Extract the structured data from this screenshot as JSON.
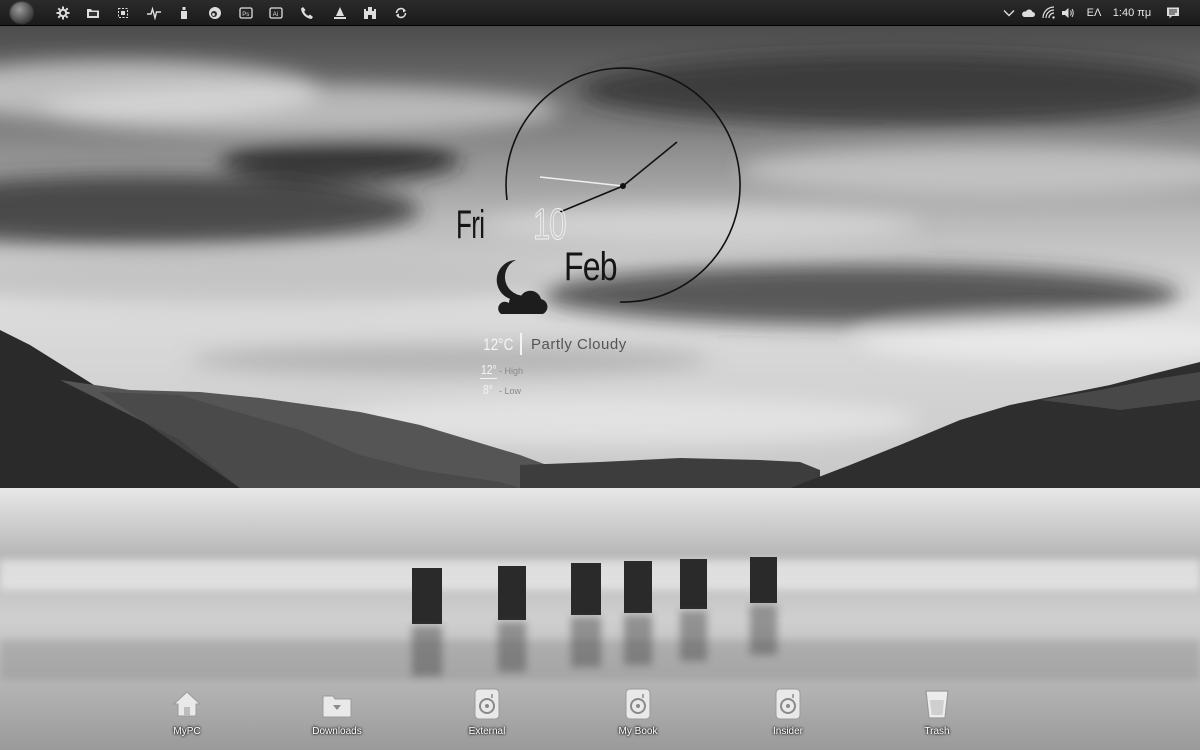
{
  "taskbar": {
    "quick_launch": [
      {
        "icon": "settings-icon"
      },
      {
        "icon": "folder-icon"
      },
      {
        "icon": "screen-capture-icon"
      },
      {
        "icon": "activity-monitor-icon"
      },
      {
        "icon": "bottle-icon"
      },
      {
        "icon": "browser-icon"
      },
      {
        "icon": "photoshop-icon"
      },
      {
        "icon": "illustrator-icon"
      },
      {
        "icon": "phone-icon"
      },
      {
        "icon": "sailing-icon"
      },
      {
        "icon": "castle-icon"
      },
      {
        "icon": "sync-icon"
      }
    ],
    "tray": {
      "chevron_icon": "chevron-down-icon",
      "cloud_icon": "onedrive-cloud-icon",
      "wifi_icon": "wifi-icon",
      "volume_icon": "volume-icon",
      "language": "ΕΛ",
      "time": "1:40 πμ",
      "notification_icon": "action-center-icon"
    }
  },
  "clock_widget": {
    "day": "Fri",
    "date": "10",
    "month": "Feb",
    "time_shown": "1:40"
  },
  "weather_widget": {
    "icon": "moon-cloud-icon",
    "temperature": "12°C",
    "condition": "Partly Cloudy",
    "high": "12°",
    "high_label": "- High",
    "low": "8°",
    "low_label": "- Low"
  },
  "dock": [
    {
      "label": "MyPC",
      "icon": "home-icon"
    },
    {
      "label": "Downloads",
      "icon": "download-folder-icon"
    },
    {
      "label": "External",
      "icon": "drive-icon"
    },
    {
      "label": "My Book",
      "icon": "drive-icon"
    },
    {
      "label": "Insider",
      "icon": "drive-icon"
    },
    {
      "label": "Trash",
      "icon": "trash-icon"
    }
  ]
}
